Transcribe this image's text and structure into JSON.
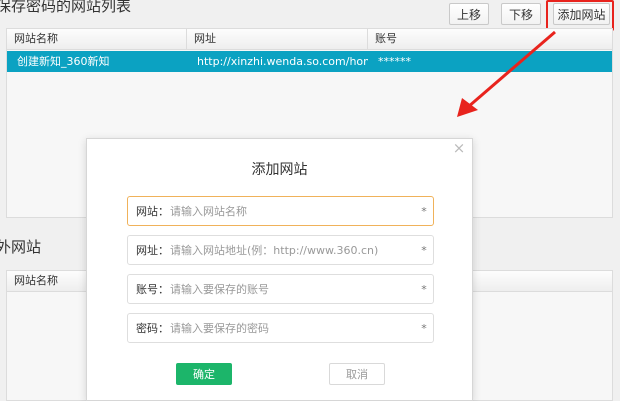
{
  "saved_list": {
    "title": "保存密码的网站列表",
    "buttons": {
      "up": "上移",
      "down": "下移",
      "add": "添加网站"
    },
    "columns": [
      "网站名称",
      "网址",
      "账号"
    ],
    "rows": [
      {
        "name": "创建新知_360新知",
        "url": "http://xinzhi.wenda.so.com/home...",
        "account": "******"
      }
    ]
  },
  "excluded_list": {
    "title": "外网站",
    "columns": [
      "网站名称"
    ]
  },
  "dialog": {
    "title": "添加网站",
    "close_icon": "×",
    "fields": {
      "site": {
        "label": "网站：",
        "placeholder": "请输入网站名称",
        "required": "*"
      },
      "url": {
        "label": "网址：",
        "placeholder": "请输入网站地址(例：http://www.360.cn)",
        "required": "*"
      },
      "account": {
        "label": "账号：",
        "placeholder": "请输入要保存的账号",
        "required": "*"
      },
      "password": {
        "label": "密码：",
        "placeholder": "请输入要保存的密码",
        "required": "*"
      }
    },
    "confirm": "确定",
    "cancel": "取消"
  },
  "colors": {
    "selected_row": "#0ba2c2",
    "highlight": "#e8231d",
    "confirm": "#1cb56a",
    "focus_border": "#f0b25a"
  }
}
